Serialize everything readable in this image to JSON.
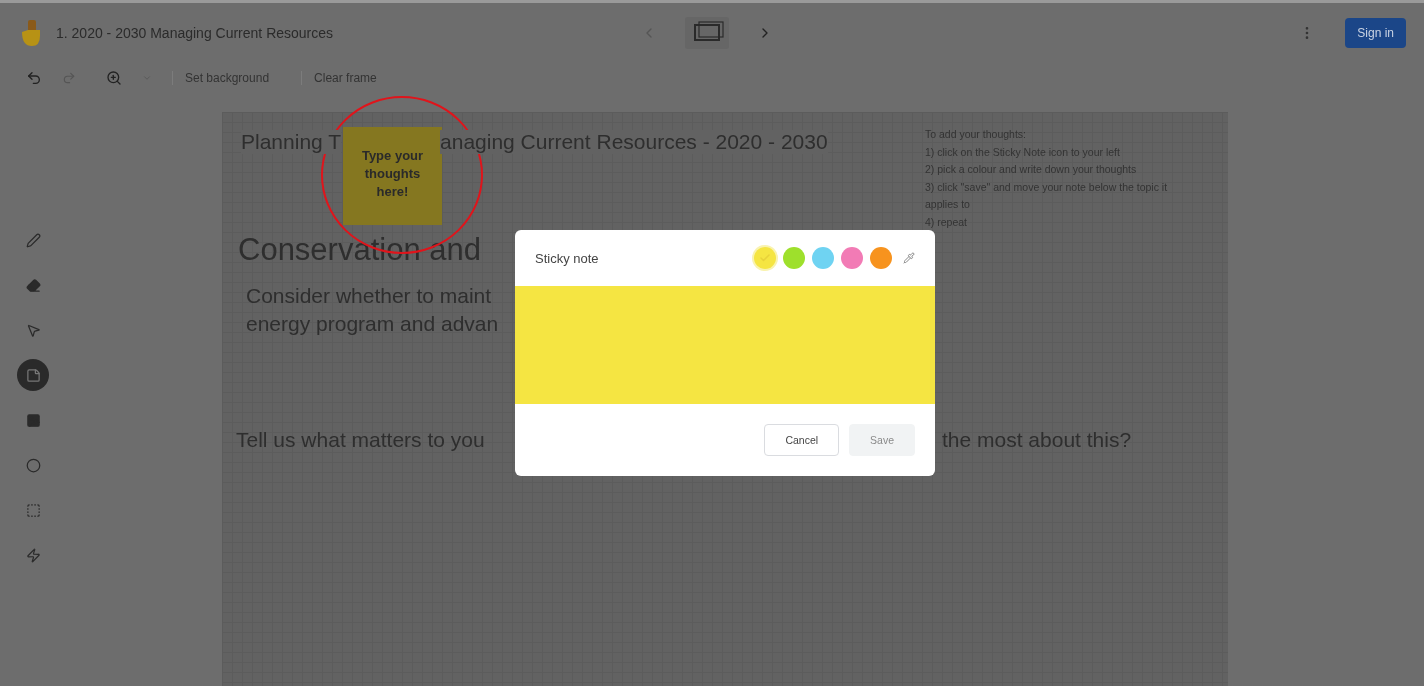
{
  "header": {
    "title": "1. 2020 - 2030 Managing Current Resources",
    "sign_in": "Sign in"
  },
  "toolbar": {
    "actions": [
      "Set background",
      "Clear frame"
    ]
  },
  "tools": [
    {
      "kind": "pen",
      "selected": false
    },
    {
      "kind": "eraser",
      "selected": false
    },
    {
      "kind": "pointer",
      "selected": false
    },
    {
      "kind": "sticky",
      "selected": true
    },
    {
      "kind": "image",
      "selected": false
    },
    {
      "kind": "circle",
      "selected": false
    },
    {
      "kind": "frame",
      "selected": false
    },
    {
      "kind": "laser",
      "selected": false
    }
  ],
  "canvas": {
    "heading_left": "Planning T",
    "heading_right": "anaging Current Resources - 2020 - 2030",
    "title": "Conservation and",
    "body_lines": [
      "Consider whether to maint",
      "energy program and advan"
    ],
    "question_left": "Tell us what matters to you",
    "question_right": "the most about this?",
    "instructions": [
      "To add your thoughts:",
      "1) click on the Sticky Note icon to your left",
      "2) pick a colour and write down your thoughts",
      "3) click \"save\" and move your note below the topic it applies to",
      "4) repeat"
    ],
    "sticky_note": {
      "text": "Type your thoughts here!",
      "highlighted": true
    }
  },
  "dialog": {
    "title": "Sticky note",
    "colors": [
      {
        "color": "#f5e542",
        "selected": true
      },
      {
        "color": "#9ee02c",
        "selected": false
      },
      {
        "color": "#6fd3f2",
        "selected": false
      },
      {
        "color": "#f27bb5",
        "selected": false
      },
      {
        "color": "#f7931e",
        "selected": false
      }
    ],
    "cancel": "Cancel",
    "save": "Save",
    "save_disabled": true
  }
}
